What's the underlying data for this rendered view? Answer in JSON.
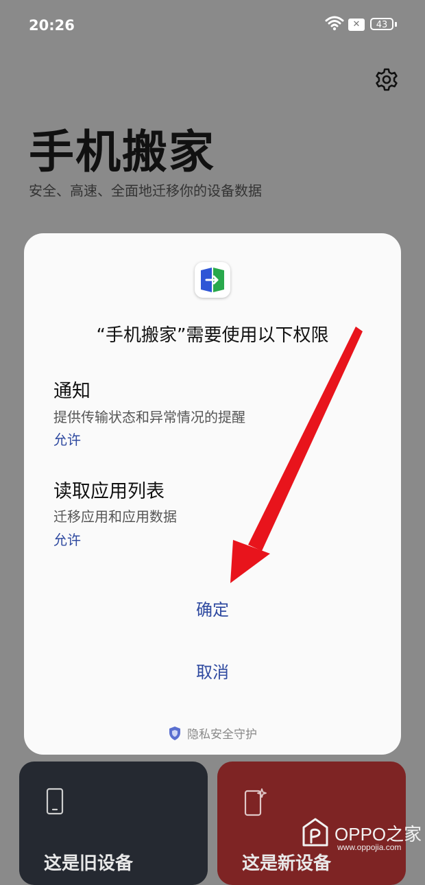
{
  "status_bar": {
    "time": "20:26",
    "sim_badge": "✕",
    "battery": "43"
  },
  "header": {
    "title": "手机搬家",
    "subtitle": "安全、高速、全面地迁移你的设备数据"
  },
  "dialog": {
    "title": "“手机搬家”需要使用以下权限",
    "permissions": [
      {
        "name": "通知",
        "description": "提供传输状态和异常情况的提醒",
        "status": "允许"
      },
      {
        "name": "读取应用列表",
        "description": "迁移应用和应用数据",
        "status": "允许"
      }
    ],
    "confirm_label": "确定",
    "cancel_label": "取消",
    "privacy_label": "隐私安全守护"
  },
  "cards": {
    "old_device": "这是旧设备",
    "new_device": "这是新设备"
  },
  "watermark": {
    "brand": "OPPO之家",
    "url": "www.oppojia.com"
  },
  "icons": [
    "wifi-icon",
    "sim-icon",
    "battery-icon",
    "gear-icon",
    "app-icon",
    "shield-icon",
    "phone-icon",
    "new-phone-icon"
  ],
  "colors": {
    "accent": "#2f4aa0",
    "overlay": "#8a8a8a",
    "dialog": "#fafafa",
    "old_card": "#252931",
    "new_card": "#7e2424",
    "annotation_arrow": "#e8141c"
  }
}
